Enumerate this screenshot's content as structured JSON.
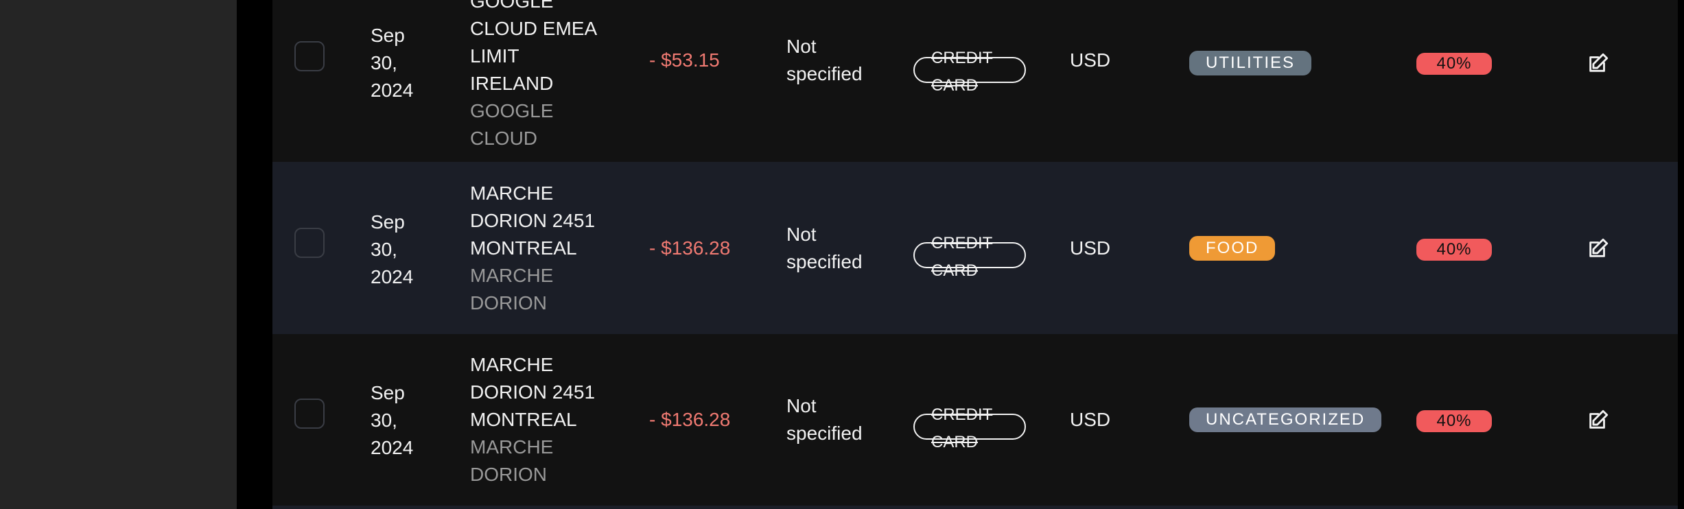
{
  "rows": [
    {
      "date": [
        "Sep",
        "30,",
        "2024"
      ],
      "merchant_name": [
        "GOOGLE",
        "CLOUD EMEA",
        "LIMIT",
        "IRELAND"
      ],
      "merchant_sub": [
        "GOOGLE",
        "CLOUD"
      ],
      "amount": "- $53.15",
      "note": [
        "Not",
        "specified"
      ],
      "method": "CREDIT CARD",
      "currency": "USD",
      "category": "UTILITIES",
      "category_color": "#64737f",
      "percent": "40%"
    },
    {
      "date": [
        "Sep",
        "30,",
        "2024"
      ],
      "merchant_name": [
        "MARCHE",
        "DORION 2451",
        "MONTREAL"
      ],
      "merchant_sub": [
        "MARCHE",
        "DORION"
      ],
      "amount": "- $136.28",
      "note": [
        "Not",
        "specified"
      ],
      "method": "CREDIT CARD",
      "currency": "USD",
      "category": "FOOD",
      "category_color": "#ef9a35",
      "percent": "40%"
    },
    {
      "date": [
        "Sep",
        "30,",
        "2024"
      ],
      "merchant_name": [
        "MARCHE",
        "DORION 2451",
        "MONTREAL"
      ],
      "merchant_sub": [
        "MARCHE",
        "DORION"
      ],
      "amount": "- $136.28",
      "note": [
        "Not",
        "specified"
      ],
      "method": "CREDIT CARD",
      "currency": "USD",
      "category": "UNCATEGORIZED",
      "category_color": "#6f7a8c",
      "percent": "40%"
    }
  ],
  "icons": {
    "edit": "edit-icon"
  }
}
